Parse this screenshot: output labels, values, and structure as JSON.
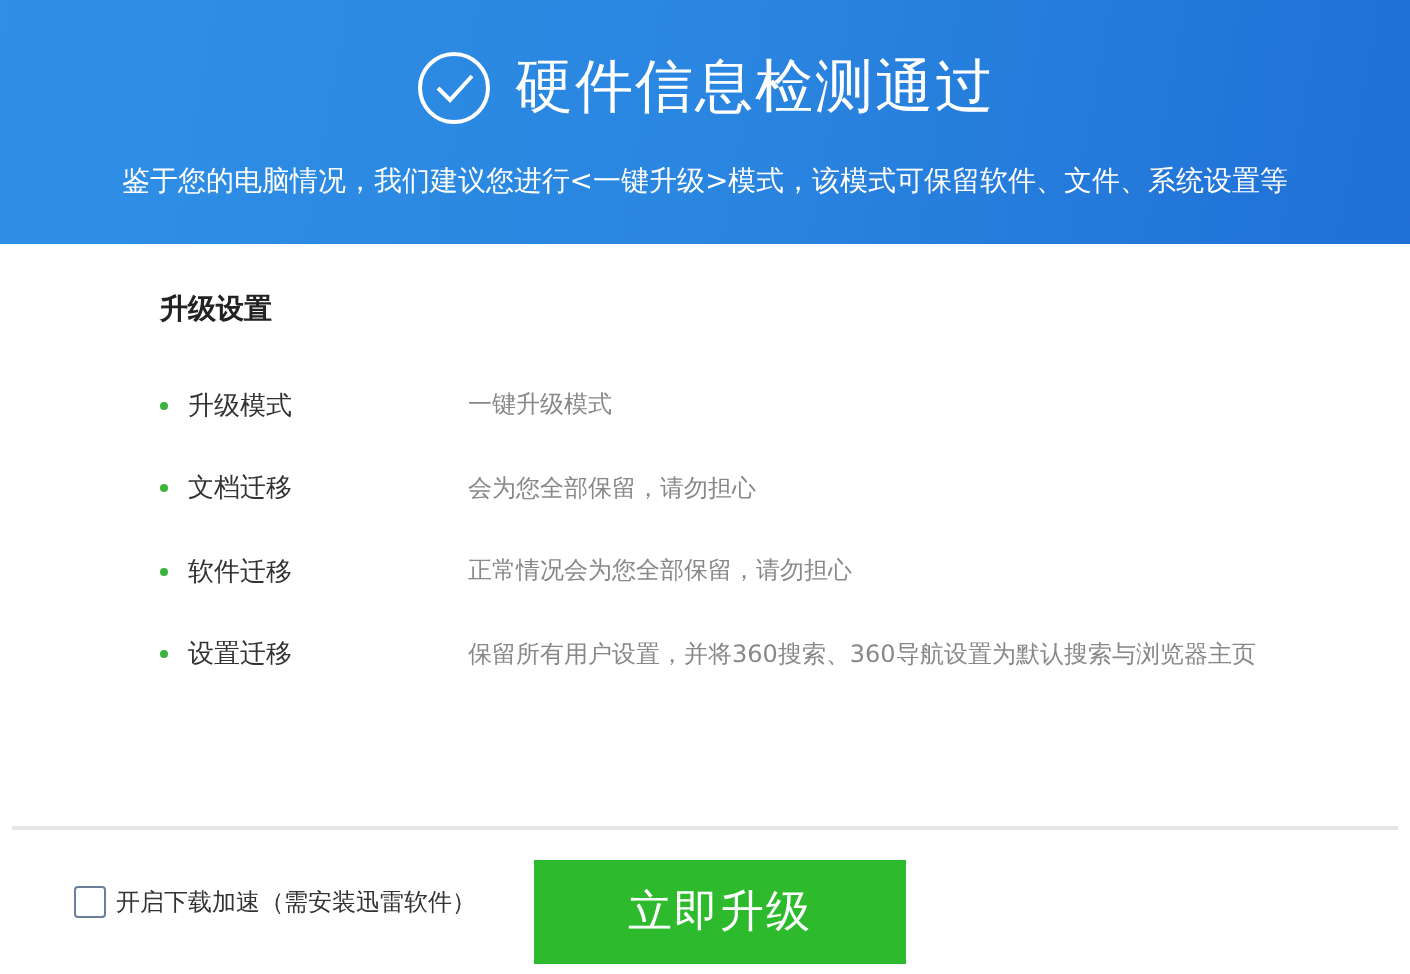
{
  "header": {
    "title": "硬件信息检测通过",
    "subtitle": "鉴于您的电脑情况，我们建议您进行<一键升级>模式，该模式可保留软件、文件、系统设置等"
  },
  "settings": {
    "title": "升级设置",
    "items": [
      {
        "label": "升级模式",
        "value": "一键升级模式"
      },
      {
        "label": "文档迁移",
        "value": "会为您全部保留，请勿担心"
      },
      {
        "label": "软件迁移",
        "value": "正常情况会为您全部保留，请勿担心"
      },
      {
        "label": "设置迁移",
        "value": "保留所有用户设置，并将360搜索、360导航设置为默认搜索与浏览器主页"
      }
    ]
  },
  "footer": {
    "option": {
      "label": "开启下载加速（需安装迅雷软件）",
      "checked": false
    },
    "button": "立即升级"
  }
}
